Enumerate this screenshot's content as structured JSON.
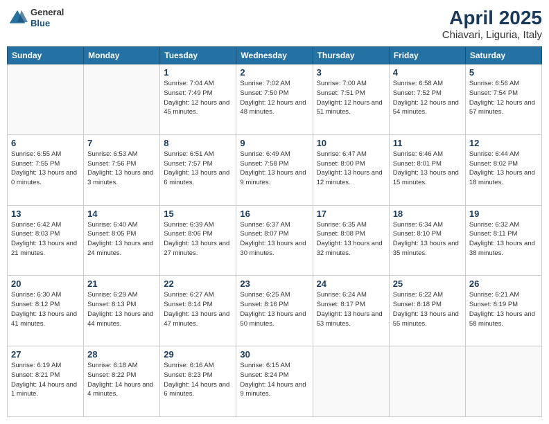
{
  "header": {
    "logo": {
      "general": "General",
      "blue": "Blue"
    },
    "title": "April 2025",
    "subtitle": "Chiavari, Liguria, Italy"
  },
  "weekdays": [
    "Sunday",
    "Monday",
    "Tuesday",
    "Wednesday",
    "Thursday",
    "Friday",
    "Saturday"
  ],
  "weeks": [
    [
      {
        "day": "",
        "sunrise": "",
        "sunset": "",
        "daylight": ""
      },
      {
        "day": "",
        "sunrise": "",
        "sunset": "",
        "daylight": ""
      },
      {
        "day": "1",
        "sunrise": "Sunrise: 7:04 AM",
        "sunset": "Sunset: 7:49 PM",
        "daylight": "Daylight: 12 hours and 45 minutes."
      },
      {
        "day": "2",
        "sunrise": "Sunrise: 7:02 AM",
        "sunset": "Sunset: 7:50 PM",
        "daylight": "Daylight: 12 hours and 48 minutes."
      },
      {
        "day": "3",
        "sunrise": "Sunrise: 7:00 AM",
        "sunset": "Sunset: 7:51 PM",
        "daylight": "Daylight: 12 hours and 51 minutes."
      },
      {
        "day": "4",
        "sunrise": "Sunrise: 6:58 AM",
        "sunset": "Sunset: 7:52 PM",
        "daylight": "Daylight: 12 hours and 54 minutes."
      },
      {
        "day": "5",
        "sunrise": "Sunrise: 6:56 AM",
        "sunset": "Sunset: 7:54 PM",
        "daylight": "Daylight: 12 hours and 57 minutes."
      }
    ],
    [
      {
        "day": "6",
        "sunrise": "Sunrise: 6:55 AM",
        "sunset": "Sunset: 7:55 PM",
        "daylight": "Daylight: 13 hours and 0 minutes."
      },
      {
        "day": "7",
        "sunrise": "Sunrise: 6:53 AM",
        "sunset": "Sunset: 7:56 PM",
        "daylight": "Daylight: 13 hours and 3 minutes."
      },
      {
        "day": "8",
        "sunrise": "Sunrise: 6:51 AM",
        "sunset": "Sunset: 7:57 PM",
        "daylight": "Daylight: 13 hours and 6 minutes."
      },
      {
        "day": "9",
        "sunrise": "Sunrise: 6:49 AM",
        "sunset": "Sunset: 7:58 PM",
        "daylight": "Daylight: 13 hours and 9 minutes."
      },
      {
        "day": "10",
        "sunrise": "Sunrise: 6:47 AM",
        "sunset": "Sunset: 8:00 PM",
        "daylight": "Daylight: 13 hours and 12 minutes."
      },
      {
        "day": "11",
        "sunrise": "Sunrise: 6:46 AM",
        "sunset": "Sunset: 8:01 PM",
        "daylight": "Daylight: 13 hours and 15 minutes."
      },
      {
        "day": "12",
        "sunrise": "Sunrise: 6:44 AM",
        "sunset": "Sunset: 8:02 PM",
        "daylight": "Daylight: 13 hours and 18 minutes."
      }
    ],
    [
      {
        "day": "13",
        "sunrise": "Sunrise: 6:42 AM",
        "sunset": "Sunset: 8:03 PM",
        "daylight": "Daylight: 13 hours and 21 minutes."
      },
      {
        "day": "14",
        "sunrise": "Sunrise: 6:40 AM",
        "sunset": "Sunset: 8:05 PM",
        "daylight": "Daylight: 13 hours and 24 minutes."
      },
      {
        "day": "15",
        "sunrise": "Sunrise: 6:39 AM",
        "sunset": "Sunset: 8:06 PM",
        "daylight": "Daylight: 13 hours and 27 minutes."
      },
      {
        "day": "16",
        "sunrise": "Sunrise: 6:37 AM",
        "sunset": "Sunset: 8:07 PM",
        "daylight": "Daylight: 13 hours and 30 minutes."
      },
      {
        "day": "17",
        "sunrise": "Sunrise: 6:35 AM",
        "sunset": "Sunset: 8:08 PM",
        "daylight": "Daylight: 13 hours and 32 minutes."
      },
      {
        "day": "18",
        "sunrise": "Sunrise: 6:34 AM",
        "sunset": "Sunset: 8:10 PM",
        "daylight": "Daylight: 13 hours and 35 minutes."
      },
      {
        "day": "19",
        "sunrise": "Sunrise: 6:32 AM",
        "sunset": "Sunset: 8:11 PM",
        "daylight": "Daylight: 13 hours and 38 minutes."
      }
    ],
    [
      {
        "day": "20",
        "sunrise": "Sunrise: 6:30 AM",
        "sunset": "Sunset: 8:12 PM",
        "daylight": "Daylight: 13 hours and 41 minutes."
      },
      {
        "day": "21",
        "sunrise": "Sunrise: 6:29 AM",
        "sunset": "Sunset: 8:13 PM",
        "daylight": "Daylight: 13 hours and 44 minutes."
      },
      {
        "day": "22",
        "sunrise": "Sunrise: 6:27 AM",
        "sunset": "Sunset: 8:14 PM",
        "daylight": "Daylight: 13 hours and 47 minutes."
      },
      {
        "day": "23",
        "sunrise": "Sunrise: 6:25 AM",
        "sunset": "Sunset: 8:16 PM",
        "daylight": "Daylight: 13 hours and 50 minutes."
      },
      {
        "day": "24",
        "sunrise": "Sunrise: 6:24 AM",
        "sunset": "Sunset: 8:17 PM",
        "daylight": "Daylight: 13 hours and 53 minutes."
      },
      {
        "day": "25",
        "sunrise": "Sunrise: 6:22 AM",
        "sunset": "Sunset: 8:18 PM",
        "daylight": "Daylight: 13 hours and 55 minutes."
      },
      {
        "day": "26",
        "sunrise": "Sunrise: 6:21 AM",
        "sunset": "Sunset: 8:19 PM",
        "daylight": "Daylight: 13 hours and 58 minutes."
      }
    ],
    [
      {
        "day": "27",
        "sunrise": "Sunrise: 6:19 AM",
        "sunset": "Sunset: 8:21 PM",
        "daylight": "Daylight: 14 hours and 1 minute."
      },
      {
        "day": "28",
        "sunrise": "Sunrise: 6:18 AM",
        "sunset": "Sunset: 8:22 PM",
        "daylight": "Daylight: 14 hours and 4 minutes."
      },
      {
        "day": "29",
        "sunrise": "Sunrise: 6:16 AM",
        "sunset": "Sunset: 8:23 PM",
        "daylight": "Daylight: 14 hours and 6 minutes."
      },
      {
        "day": "30",
        "sunrise": "Sunrise: 6:15 AM",
        "sunset": "Sunset: 8:24 PM",
        "daylight": "Daylight: 14 hours and 9 minutes."
      },
      {
        "day": "",
        "sunrise": "",
        "sunset": "",
        "daylight": ""
      },
      {
        "day": "",
        "sunrise": "",
        "sunset": "",
        "daylight": ""
      },
      {
        "day": "",
        "sunrise": "",
        "sunset": "",
        "daylight": ""
      }
    ]
  ]
}
